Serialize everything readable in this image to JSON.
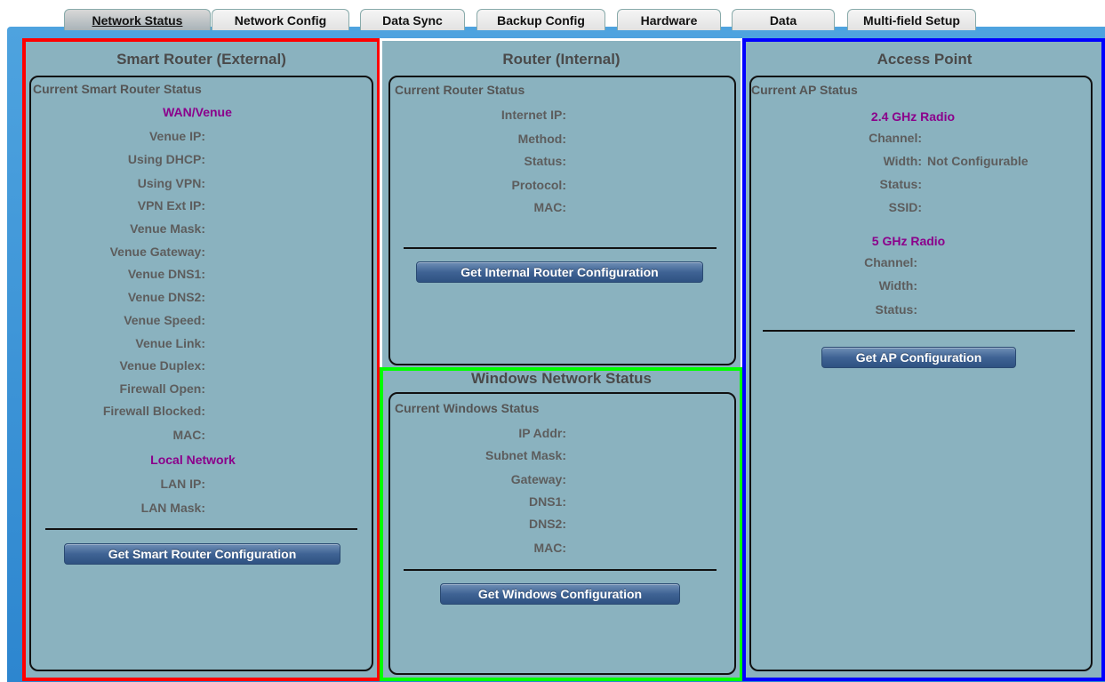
{
  "tabs": [
    {
      "label": "Network Status"
    },
    {
      "label": "Network Config"
    },
    {
      "label": "Data Sync"
    },
    {
      "label": "Backup Config"
    },
    {
      "label": "Hardware"
    },
    {
      "label": "Data"
    },
    {
      "label": "Multi-field Setup"
    }
  ],
  "smart_router": {
    "title": "Smart Router (External)",
    "legend": "Current Smart Router Status",
    "wan_heading": "WAN/Venue",
    "fields": [
      {
        "label": "Venue IP:",
        "value": ""
      },
      {
        "label": "Using DHCP:",
        "value": ""
      },
      {
        "label": "Using VPN:",
        "value": ""
      },
      {
        "label": "VPN Ext IP:",
        "value": ""
      },
      {
        "label": "Venue Mask:",
        "value": ""
      },
      {
        "label": "Venue Gateway:",
        "value": ""
      },
      {
        "label": "Venue DNS1:",
        "value": ""
      },
      {
        "label": "Venue DNS2:",
        "value": ""
      },
      {
        "label": "Venue Speed:",
        "value": ""
      },
      {
        "label": "Venue Link:",
        "value": ""
      },
      {
        "label": "Venue Duplex:",
        "value": ""
      },
      {
        "label": "Firewall Open:",
        "value": ""
      },
      {
        "label": "Firewall Blocked:",
        "value": ""
      },
      {
        "label": "MAC:",
        "value": ""
      }
    ],
    "local_heading": "Local Network",
    "local_fields": [
      {
        "label": "LAN IP:",
        "value": ""
      },
      {
        "label": "LAN Mask:",
        "value": ""
      }
    ],
    "button": "Get Smart Router Configuration"
  },
  "router": {
    "title": "Router (Internal)",
    "legend": "Current Router Status",
    "fields": [
      {
        "label": "Internet IP:",
        "value": ""
      },
      {
        "label": "Method:",
        "value": ""
      },
      {
        "label": "Status:",
        "value": ""
      },
      {
        "label": "Protocol:",
        "value": ""
      },
      {
        "label": "MAC:",
        "value": ""
      }
    ],
    "button": "Get Internal Router Configuration"
  },
  "windows": {
    "title": "Windows Network Status",
    "legend": "Current Windows Status",
    "fields": [
      {
        "label": "IP Addr:",
        "value": ""
      },
      {
        "label": "Subnet Mask:",
        "value": ""
      },
      {
        "label": "Gateway:",
        "value": ""
      },
      {
        "label": "DNS1:",
        "value": ""
      },
      {
        "label": "DNS2:",
        "value": ""
      },
      {
        "label": "MAC:",
        "value": ""
      }
    ],
    "button": "Get Windows Configuration"
  },
  "access_point": {
    "title": "Access Point",
    "legend": "Current AP Status",
    "radio24_heading": "2.4 GHz Radio",
    "radio24_fields": [
      {
        "label": "Channel:",
        "value": ""
      },
      {
        "label": "Width:",
        "value": "Not Configurable"
      },
      {
        "label": "Status:",
        "value": ""
      },
      {
        "label": "SSID:",
        "value": ""
      }
    ],
    "radio5_heading": "5 GHz Radio",
    "radio5_fields": [
      {
        "label": "Channel:",
        "value": ""
      },
      {
        "label": "Width:",
        "value": ""
      },
      {
        "label": "Status:",
        "value": ""
      }
    ],
    "button": "Get AP Configuration"
  },
  "colors": {
    "panel_bg": "#8ab2bf",
    "frame_bg": "#2d86cf",
    "section_heading": "#8b008b",
    "highlight_smart_router": "#ff0000",
    "highlight_router": "#ffffff",
    "highlight_windows": "#00ff00",
    "highlight_access_point": "#0000ff"
  }
}
